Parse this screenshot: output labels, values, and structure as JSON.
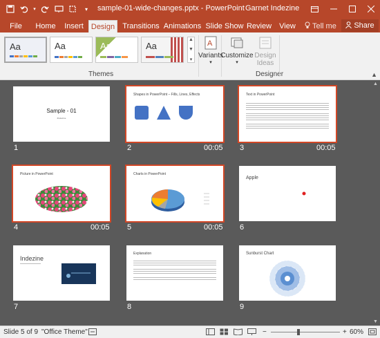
{
  "window": {
    "title": "sample-01-wide-changes.pptx - PowerPoint",
    "user": "Garnet Indezine"
  },
  "tabs": [
    "File",
    "Home",
    "Insert",
    "Design",
    "Transitions",
    "Animations",
    "Slide Show",
    "Review",
    "View"
  ],
  "tell_me": "Tell me",
  "share": "Share",
  "ribbon": {
    "theme_aa": "Aa",
    "themes_label": "Themes",
    "variants_label": "Variants",
    "customize_label": "Customize",
    "design_ideas_line1": "Design",
    "design_ideas_line2": "Ideas",
    "designer_label": "Designer"
  },
  "slides": [
    {
      "num": "1",
      "time": "",
      "title": "Sample - 01",
      "subtitle": "#indezine"
    },
    {
      "num": "2",
      "time": "00:05",
      "title": "Shapes in PowerPoint – Fills, Lines, Effects"
    },
    {
      "num": "3",
      "time": "00:05",
      "title": "Text in PowerPoint"
    },
    {
      "num": "4",
      "time": "00:05",
      "title": "Picture in PowerPoint"
    },
    {
      "num": "5",
      "time": "00:05",
      "title": "Charts in PowerPoint"
    },
    {
      "num": "6",
      "time": "",
      "title": "Apple"
    },
    {
      "num": "7",
      "time": "",
      "title": "Indezine"
    },
    {
      "num": "8",
      "time": "",
      "title": "Explanation"
    },
    {
      "num": "9",
      "time": "",
      "title": "Sunburst Chart"
    }
  ],
  "status": {
    "slide_info": "Slide 5 of 9",
    "theme": "\"Office Theme\"",
    "zoom": "60%"
  },
  "colors": {
    "accent": "#b7472a",
    "selection": "#d24726",
    "shape_blue": "#4472c4"
  }
}
